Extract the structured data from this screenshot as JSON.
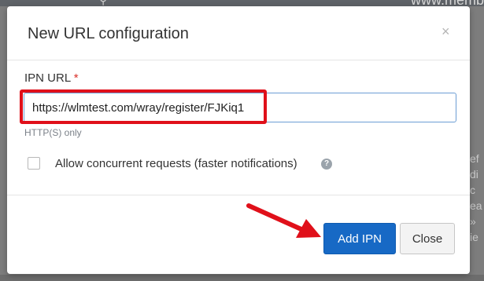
{
  "background": {
    "url_fragment": "www.memb",
    "side_letters": [
      "ef",
      "di",
      "c",
      "ea",
      "»",
      "ie"
    ]
  },
  "modal": {
    "title": "New URL configuration",
    "close_symbol": "×",
    "field": {
      "label": "IPN URL",
      "required_marker": "*",
      "value": "https://wlmtest.com/wray/register/FJKiq1",
      "hint": "HTTP(S) only"
    },
    "checkbox": {
      "label": "Allow concurrent requests (faster notifications)",
      "checked": false,
      "help_symbol": "?"
    },
    "buttons": {
      "primary": "Add IPN",
      "secondary": "Close"
    }
  },
  "annotations": {
    "highlight_color": "#e0101a",
    "arrow_color": "#e0101a"
  }
}
